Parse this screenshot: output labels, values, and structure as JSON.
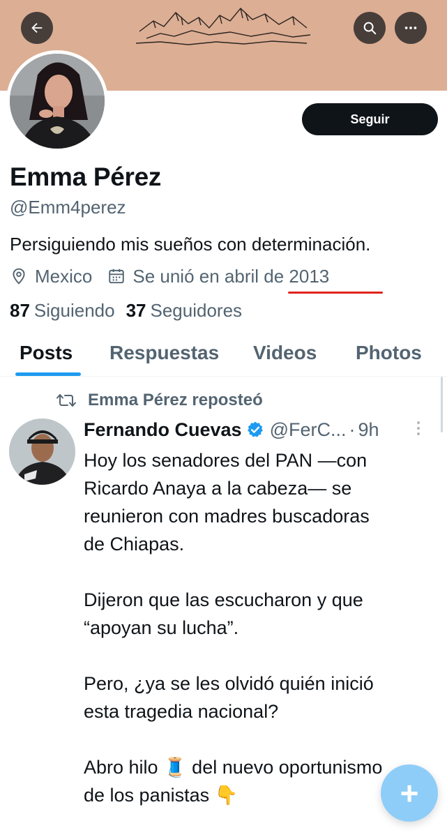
{
  "profile": {
    "name": "Emma Pérez",
    "handle": "@Emm4perez",
    "bio": "Persiguiendo mis sueños con determinación.",
    "location": "Mexico",
    "joined": "Se unió en abril de 2013",
    "following_count": "87",
    "following_label": "Siguiendo",
    "followers_count": "37",
    "followers_label": "Seguidores",
    "follow_label": "Seguir"
  },
  "icons": {
    "back": "arrow-left-icon",
    "search": "search-icon",
    "more": "more-horizontal-icon",
    "location": "location-pin-icon",
    "calendar": "calendar-icon",
    "repost": "repost-icon",
    "verified": "verified-badge-icon",
    "compose": "plus-icon"
  },
  "tabs": [
    {
      "label": "Posts",
      "active": true
    },
    {
      "label": "Respuestas",
      "active": false
    },
    {
      "label": "Videos",
      "active": false
    },
    {
      "label": "Photos",
      "active": false
    }
  ],
  "tweet": {
    "repost_label": "Emma Pérez reposteó",
    "author_name": "Fernando Cuevas",
    "author_handle": "@FerC...",
    "separator": "·",
    "time": "9h",
    "body_lines": [
      "Hoy los senadores del PAN —con",
      "Ricardo Anaya a la cabeza— se",
      "reunieron con madres buscadoras",
      "de Chiapas.",
      "Dijeron que las escucharon y que",
      "“apoyan su lucha”.",
      "Pero, ¿ya se les olvidó quién inició",
      "esta tragedia nacional?",
      "Abro hilo 🧵 del nuevo oportunismo",
      "de los panistas 👇"
    ]
  },
  "fab_label": "+",
  "colors": {
    "accent": "#1d9bf0",
    "banner": "#dcae94",
    "follow_button": "#0f1419",
    "annotation_underline": "#e0231c",
    "fab": "#8ecdf8"
  }
}
